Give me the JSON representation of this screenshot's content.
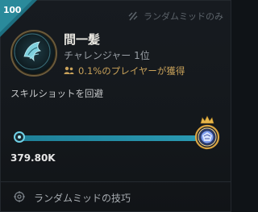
{
  "rank_badge": {
    "number": "100"
  },
  "mode_tag": {
    "label": "ランダムミッドのみ",
    "icon": "rune-icon"
  },
  "challenge": {
    "title": "間一髪",
    "tier_text": "チャレンジャー 1位",
    "players_text": "0.1%のプレイヤーが獲得",
    "description": "スキルショットを回避"
  },
  "progress": {
    "current_value_text": "379.80K",
    "fraction": 1.0
  },
  "footer": {
    "tips_label": "ランダムミッドの技巧"
  },
  "colors": {
    "accent_teal": "#2a9ab3",
    "gold": "#c9a25a",
    "ribbon": "#2a8a9b"
  }
}
